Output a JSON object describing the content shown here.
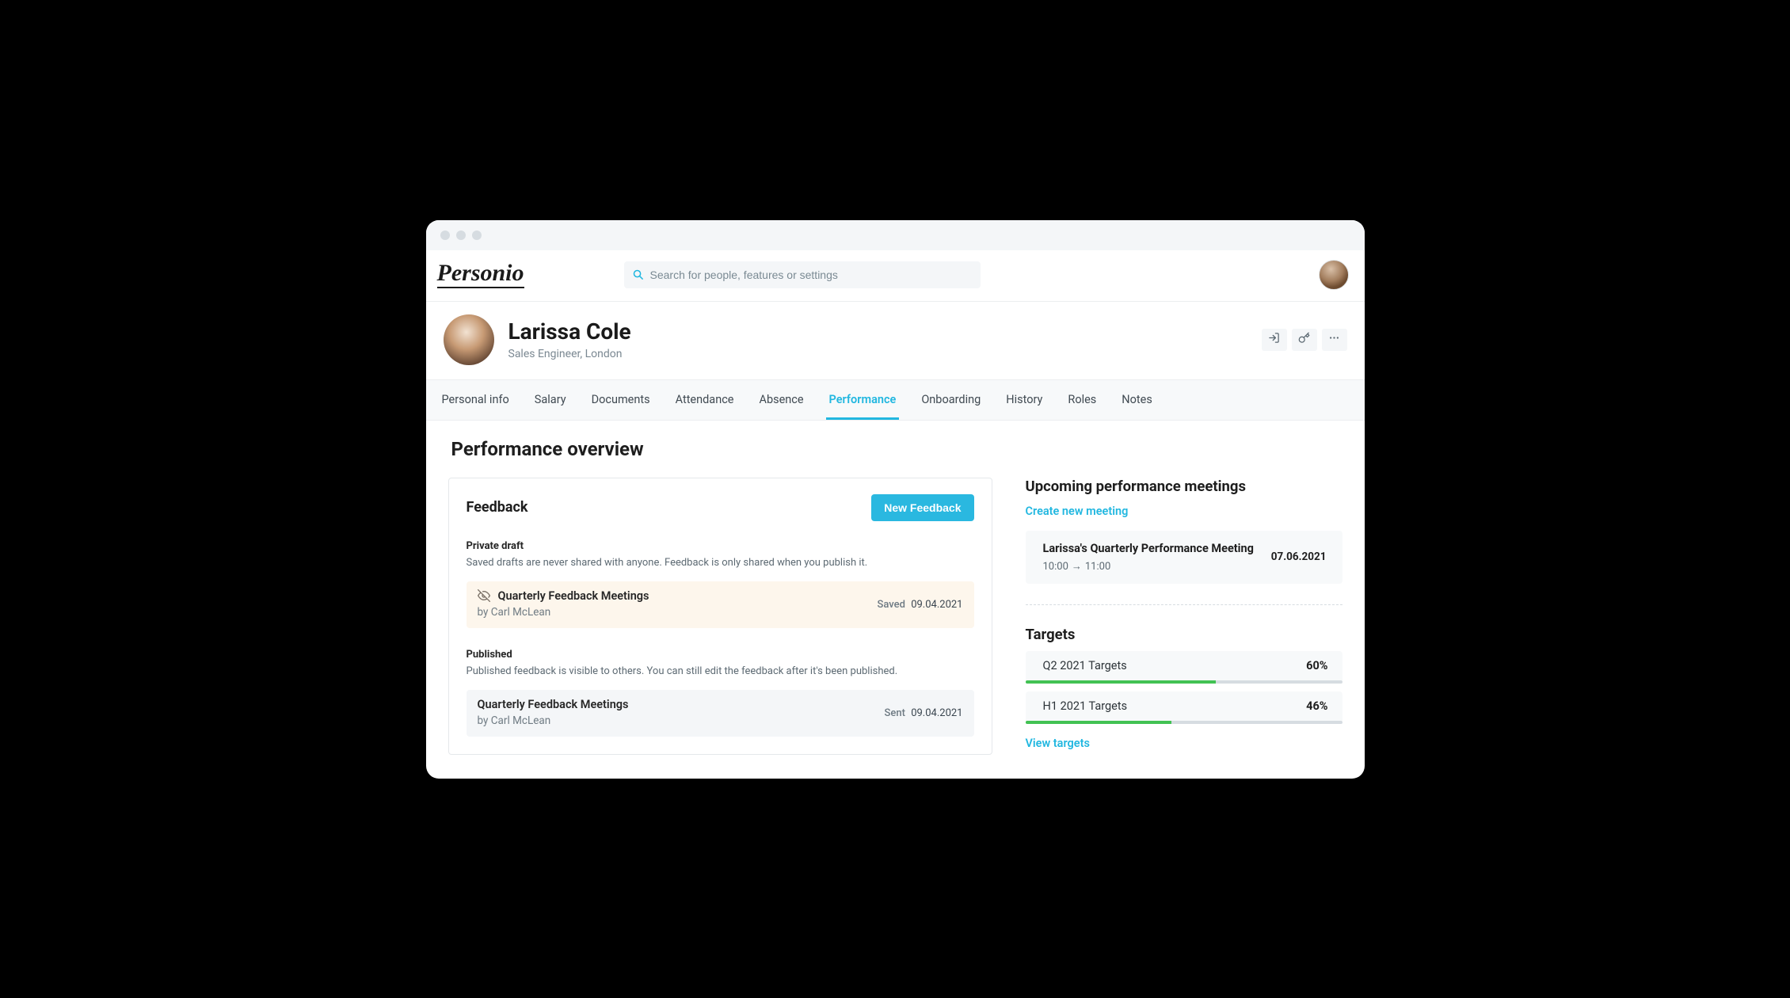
{
  "brand": "Personio",
  "search": {
    "placeholder": "Search for people, features or settings"
  },
  "profile": {
    "name": "Larissa Cole",
    "role_location": "Sales Engineer, London"
  },
  "tabs": [
    "Personal info",
    "Salary",
    "Documents",
    "Attendance",
    "Absence",
    "Performance",
    "Onboarding",
    "History",
    "Roles",
    "Notes"
  ],
  "active_tab_index": 5,
  "page_title": "Performance overview",
  "feedback": {
    "title": "Feedback",
    "new_button": "New Feedback",
    "private": {
      "label": "Private draft",
      "desc": "Saved drafts are never shared with anyone. Feedback is only shared when you publish it.",
      "item": {
        "title": "Quarterly Feedback Meetings",
        "author_prefix": "by ",
        "author": "Carl McLean",
        "status": "Saved",
        "date": "09.04.2021"
      }
    },
    "published": {
      "label": "Published",
      "desc": "Published feedback is visible to others. You can still edit the feedback after it's been published.",
      "item": {
        "title": "Quarterly Feedback Meetings",
        "author_prefix": "by ",
        "author": "Carl McLean",
        "status": "Sent",
        "date": "09.04.2021"
      }
    }
  },
  "meetings": {
    "heading": "Upcoming performance meetings",
    "create_link": "Create new meeting",
    "item": {
      "title": "Larissa's Quarterly Performance Meeting",
      "time_start": "10:00",
      "time_end": "11:00",
      "date": "07.06.2021"
    }
  },
  "targets": {
    "heading": "Targets",
    "rows": [
      {
        "name": "Q2 2021 Targets",
        "pct": "60%",
        "value": 60
      },
      {
        "name": "H1 2021 Targets",
        "pct": "46%",
        "value": 46
      }
    ],
    "view_link": "View targets"
  }
}
